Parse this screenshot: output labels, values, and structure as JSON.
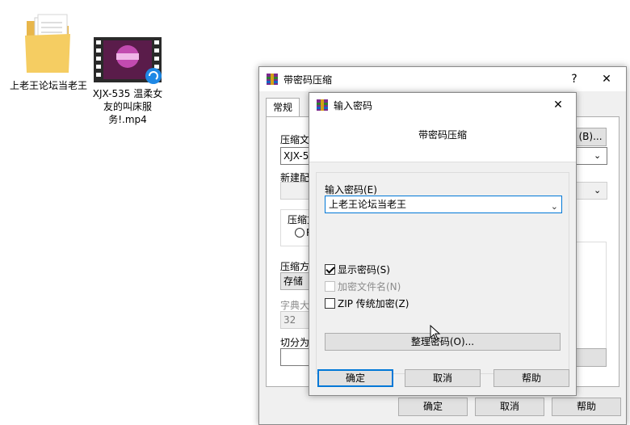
{
  "desktop": {
    "icons": [
      {
        "label": "上老王论坛当老王",
        "icon": "folder-icon"
      },
      {
        "label": "XJX-535 温柔女友的叫床服务!.mp4",
        "icon": "video-file-icon"
      }
    ]
  },
  "outer_dialog": {
    "title": "带密码压缩",
    "help_glyph": "?",
    "close_glyph": "✕",
    "tab_general": "常规",
    "archive_name_label": "压缩文",
    "browse_button": "(B)...",
    "archive_name_value": "XJX-53",
    "profile_label": "新建配",
    "format_group_label": "压缩文",
    "radio_label": "R",
    "method_label": "压缩方",
    "method_value": "存储",
    "dict_label": "字典大",
    "dict_value": "32",
    "split_label": "切分为",
    "ok_button": "确定",
    "cancel_button": "取消",
    "help_button": "帮助"
  },
  "password_dialog": {
    "title": "输入密码",
    "close_glyph": "✕",
    "header": "带密码压缩",
    "password_label": "输入密码(E)",
    "password_value": "上老王论坛当老王",
    "show_password": {
      "label": "显示密码(S)",
      "checked": true,
      "enabled": true
    },
    "encrypt_filenames": {
      "label": "加密文件名(N)",
      "checked": false,
      "enabled": false
    },
    "zip_legacy": {
      "label": "ZIP 传统加密(Z)",
      "checked": false,
      "enabled": true
    },
    "organize_button": "整理密码(O)...",
    "ok_button": "确定",
    "cancel_button": "取消",
    "help_button": "帮助"
  },
  "colors": {
    "accent": "#0078d7",
    "dialog_bg": "#f0f0f0",
    "button_bg": "#e1e1e1"
  }
}
